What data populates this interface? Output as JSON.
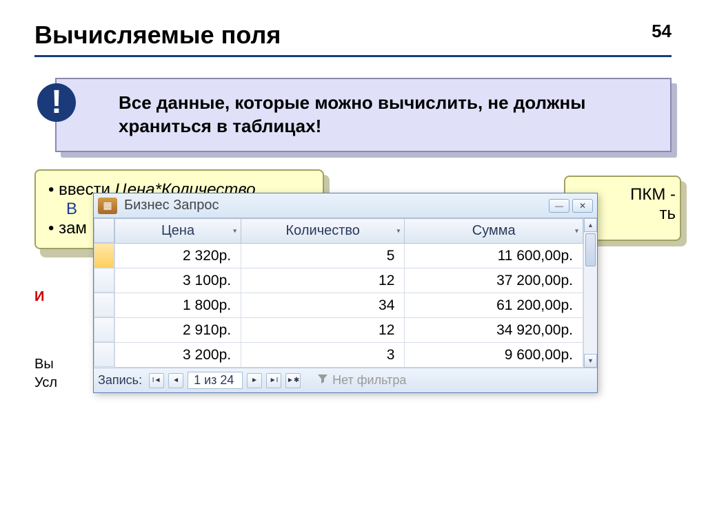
{
  "header": {
    "title": "Вычисляемые поля",
    "page": "54"
  },
  "callout": {
    "text": "Все данные, которые можно вычислить, не должны храниться в таблицах!",
    "mark": "!"
  },
  "yellow_left": {
    "bullet1_prefix": "ввести ",
    "bullet1_italic": "Цена*Количество",
    "indent_partial": "В",
    "bullet2": "зам"
  },
  "yellow_right": {
    "frag1": "ПКМ -",
    "frag2": "ть"
  },
  "bg_table": {
    "red": "И",
    "row1": "Вы",
    "row2": "Усл"
  },
  "window": {
    "title": "Бизнес Запрос",
    "columns": [
      "Цена",
      "Количество",
      "Сумма"
    ],
    "rows": [
      {
        "price": "2 320р.",
        "qty": "5",
        "sum": "11 600,00р."
      },
      {
        "price": "3 100р.",
        "qty": "12",
        "sum": "37 200,00р."
      },
      {
        "price": "1 800р.",
        "qty": "34",
        "sum": "61 200,00р."
      },
      {
        "price": "2 910р.",
        "qty": "12",
        "sum": "34 920,00р."
      },
      {
        "price": "3 200р.",
        "qty": "3",
        "sum": "9 600,00р."
      }
    ],
    "status": {
      "label": "Запись:",
      "position": "1 из 24",
      "nofilter": "Нет фильтра"
    }
  }
}
